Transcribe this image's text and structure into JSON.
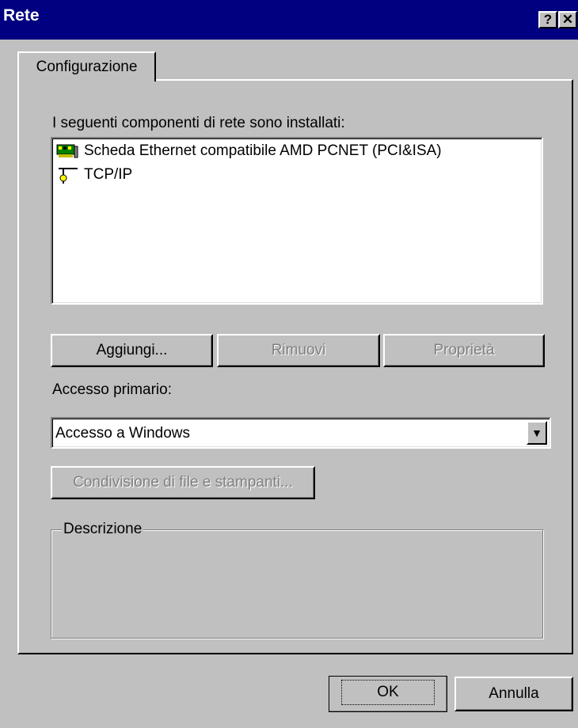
{
  "window": {
    "title": "Rete",
    "help_glyph": "?",
    "close_glyph": "✕"
  },
  "tabs": [
    {
      "label": "Configurazione"
    }
  ],
  "components": {
    "label": "I seguenti componenti di rete sono installati:",
    "items": [
      {
        "label": "Scheda Ethernet compatibile AMD PCNET (PCI&ISA)",
        "icon": "network-card-icon"
      },
      {
        "label": "TCP/IP",
        "icon": "protocol-icon"
      }
    ]
  },
  "buttons": {
    "add": "Aggiungi...",
    "remove": "Rimuovi",
    "properties": "Proprietà"
  },
  "logon": {
    "label": "Accesso primario:",
    "value": "Accesso a Windows"
  },
  "share": {
    "label": "Condivisione di file e stampanti..."
  },
  "description": {
    "label": "Descrizione"
  },
  "footer": {
    "ok": "OK",
    "cancel": "Annulla"
  }
}
